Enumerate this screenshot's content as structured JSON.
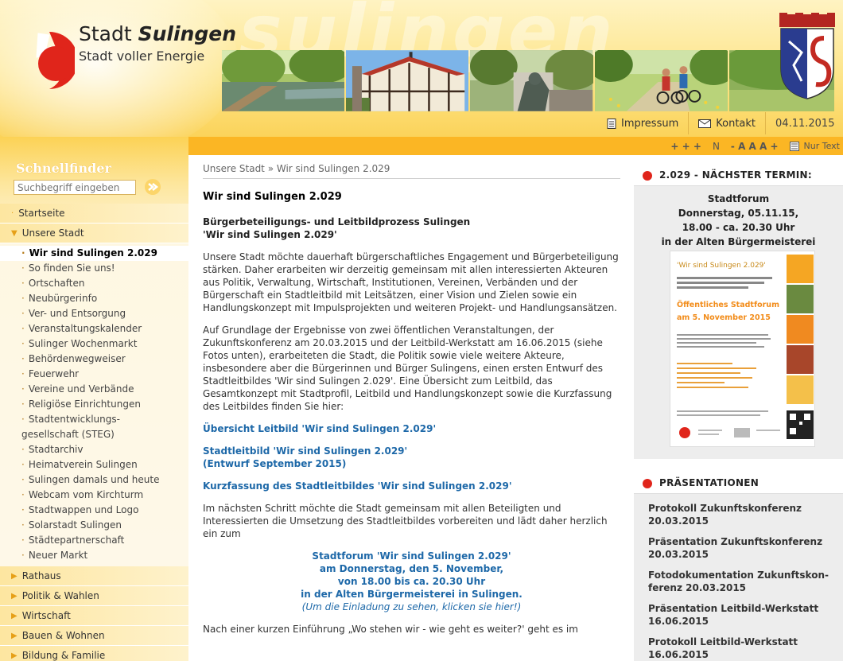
{
  "header": {
    "watermark": "sulingen",
    "title_prefix": "Stadt ",
    "title_name": "Sulingen",
    "slogan": "Stadt voller Energie",
    "toolbar": {
      "impressum": "Impressum",
      "kontakt": "Kontakt",
      "date": "04.11.2015"
    },
    "tools": {
      "plus": "+ + +",
      "n": "N",
      "font_sizes": "- A A A +",
      "nur_text": "Nur Text"
    }
  },
  "sidebar": {
    "title": "Schnellfinder",
    "search_placeholder": "Suchbegriff eingeben",
    "nav_top": [
      {
        "label": "Startseite"
      },
      {
        "label": "Unsere Stadt"
      }
    ],
    "nav_sub": [
      {
        "label": "Wir sind Sulingen 2.029",
        "active": true
      },
      {
        "label": "So finden Sie uns!"
      },
      {
        "label": "Ortschaften"
      },
      {
        "label": "Neubürgerinfo"
      },
      {
        "label": "Ver- und Entsorgung"
      },
      {
        "label": "Veranstaltungskalender"
      },
      {
        "label": "Sulinger Wochenmarkt"
      },
      {
        "label": "Behördenwegweiser"
      },
      {
        "label": "Feuerwehr"
      },
      {
        "label": "Vereine und Verbände"
      },
      {
        "label": "Religiöse Einrichtungen"
      },
      {
        "label": "Stadtentwicklungs-"
      },
      {
        "label": "gesellschaft (STEG)"
      },
      {
        "label": "Stadtarchiv"
      },
      {
        "label": "Heimatverein Sulingen"
      },
      {
        "label": "Sulingen damals und heute"
      },
      {
        "label": "Webcam vom Kirchturm"
      },
      {
        "label": "Stadtwappen und Logo"
      },
      {
        "label": "Solarstadt Sulingen"
      },
      {
        "label": "Städtepartnerschaft"
      },
      {
        "label": "Neuer Markt"
      }
    ],
    "nav_bottom": [
      {
        "label": "Rathaus"
      },
      {
        "label": "Politik & Wahlen"
      },
      {
        "label": "Wirtschaft"
      },
      {
        "label": "Bauen & Wohnen"
      },
      {
        "label": "Bildung & Familie"
      }
    ]
  },
  "main": {
    "breadcrumb": "Unsere Stadt » Wir sind Sulingen 2.029",
    "title": "Wir sind Sulingen 2.029",
    "subhead_1": "Bürgerbeteiligungs- und Leitbildprozess Sulingen",
    "subhead_2": "'Wir sind Sulingen 2.029'",
    "para_1": "Unsere Stadt möchte dauerhaft bürgerschaftliches Engagement und Bürgerbeteiligung stärken. Daher erarbeiten wir derzeitig gemeinsam mit allen interessierten Akteuren aus Politik, Verwaltung, Wirtschaft, Institutionen, Vereinen, Verbänden und der Bürgerschaft ein Stadtleitbild mit Leitsätzen, einer Vision und Zielen sowie ein Handlungskonzept mit Impulsprojekten und weiteren Projekt- und Handlungsansätzen.",
    "para_2": "Auf Grundlage der Ergebnisse von zwei öffentlichen Veranstaltungen, der Zukunftskonferenz am 20.03.2015 und der Leitbild-Werkstatt am 16.06.2015 (siehe Fotos unten), erarbeiteten die Stadt, die Politik sowie viele weitere Akteure, insbesondere aber die Bürgerinnen und Bürger Sulingens, einen ersten Entwurf des Stadtleitbildes 'Wir sind Sulingen 2.029'. Eine Übersicht zum Leitbild, das Gesamtkonzept mit Stadtprofil, Leitbild und Handlungskonzept sowie die Kurzfassung des Leitbildes finden Sie hier:",
    "link_1": "Übersicht Leitbild 'Wir sind Sulingen 2.029'",
    "link_2a": "Stadtleitbild 'Wir sind Sulingen 2.029'",
    "link_2b": "(Entwurf September 2015)",
    "link_3": "Kurzfassung des Stadtleitbildes 'Wir sind Sulingen 2.029'",
    "para_3": "Im nächsten Schritt möchte die Stadt gemeinsam mit allen Beteiligten und Interessierten die Umsetzung des Stadtleitbildes vorbereiten und lädt daher herzlich ein zum",
    "event_1": "Stadtforum 'Wir sind Sulingen 2.029'",
    "event_2": "am Donnerstag, den 5. November,",
    "event_3": "von 18.00 bis ca. 20.30 Uhr",
    "event_4": "in der Alten Bürgermeisterei in Sulingen.",
    "event_invite": "(Um die Einladung zu sehen, klicken sie hier!)",
    "para_4": "Nach einer kurzen Einführung „Wo stehen wir - wie geht es weiter?' geht es im"
  },
  "right": {
    "termin_title": "2.029 - NÄCHSTER TERMIN:",
    "termin_1": "Stadtforum",
    "termin_2": "Donnerstag, 05.11.15,",
    "termin_3": "18.00 - ca. 20.30 Uhr",
    "termin_4": "in der Alten Bürgermeisterei",
    "flyer_title": "'Wir sind Sulingen 2.029'",
    "flyer_headline_1": "Öffentliches Stadtforum",
    "flyer_headline_2": "am 5. November 2015",
    "praes_title": "PRÄSENTATIONEN",
    "praes_items": [
      {
        "line1": "Protokoll Zukunftskonferenz",
        "line2": "20.03.2015"
      },
      {
        "line1": "Präsentation Zukunftskonferenz",
        "line2": "20.03.2015"
      },
      {
        "line1": "Fotodokumentation Zukunftskon-",
        "line2": "ferenz 20.03.2015"
      },
      {
        "line1": "Präsentation Leitbild-Werkstatt",
        "line2": "16.06.2015"
      },
      {
        "line1": "Protokoll Leitbild-Werkstatt",
        "line2": "16.06.2015"
      }
    ]
  },
  "colors": {
    "accent_orange": "#fbb624",
    "link_blue": "#1d68a8",
    "logo_red": "#e0251b",
    "logo_yellow": "#f6b71e"
  }
}
